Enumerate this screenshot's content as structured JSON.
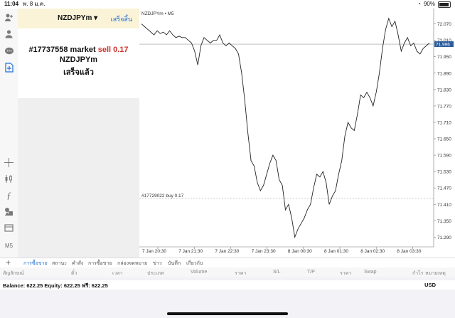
{
  "status_bar": {
    "time": "11:04",
    "date": "พ. 8 ม.ค.",
    "battery": "90%",
    "battery_level": 0.9
  },
  "panel": {
    "symbol": "NZDJPYm ▾",
    "done_label": "เสร็จสิ้น",
    "order_line": "#17737558 market",
    "order_side": "sell",
    "order_volume": "0.17",
    "order_symbol": "NZDJPYm",
    "order_status": "เสร็จแล้ว"
  },
  "toolbar": {
    "icons": [
      "user-add-icon",
      "account-icon",
      "chat-icon",
      "new-order-icon",
      "crosshair-icon",
      "candles-icon",
      "indicator-f-icon",
      "objects-icon",
      "template-icon",
      "timeframe-m5"
    ],
    "timeframe": "M5"
  },
  "chart": {
    "label": "NZDJPYm • M5",
    "price_tag": "71.996",
    "order_line_label": "#17729022 buy 0.17"
  },
  "chart_data": {
    "type": "line",
    "symbol": "NZDJPYm",
    "timeframe": "M5",
    "y_ticks": [
      "72.070",
      "72.010",
      "71.950",
      "71.890",
      "71.830",
      "71.770",
      "71.710",
      "71.650",
      "71.590",
      "71.530",
      "71.470",
      "71.410",
      "71.350",
      "71.290"
    ],
    "x_ticks": [
      "7 Jan 20:30",
      "7 Jan 21:30",
      "7 Jan 22:30",
      "7 Jan 23:30",
      "8 Jan 00:30",
      "8 Jan 01:30",
      "8 Jan 02:30",
      "8 Jan 03:30"
    ],
    "ylim": [
      71.265,
      72.095
    ],
    "current_price": 71.996,
    "order_level": 71.432,
    "series": [
      {
        "values": [
          72.07,
          72.06,
          72.05,
          72.04,
          72.03,
          72.045,
          72.035,
          72.04,
          72.03,
          72.045,
          72.03,
          72.02,
          72.025,
          72.02,
          72.02,
          72.01,
          72.0,
          71.97,
          71.92,
          71.99,
          72.02,
          72.01,
          72.0,
          72.01,
          72.01,
          72.03,
          72.0,
          71.99,
          72.0,
          71.99,
          71.98,
          71.96,
          71.89,
          71.79,
          71.67,
          71.57,
          71.55,
          71.49,
          71.46,
          71.48,
          71.52,
          71.56,
          71.59,
          71.57,
          71.5,
          71.48,
          71.39,
          71.41,
          71.36,
          71.29,
          71.32,
          71.34,
          71.36,
          71.39,
          71.41,
          71.47,
          71.52,
          71.51,
          71.53,
          71.49,
          71.41,
          71.44,
          71.46,
          71.52,
          71.57,
          71.66,
          71.71,
          71.69,
          71.68,
          71.74,
          71.81,
          71.8,
          71.82,
          71.8,
          71.77,
          71.82,
          71.89,
          71.98,
          72.05,
          72.09,
          72.06,
          72.08,
          72.03,
          71.97,
          72.0,
          72.02,
          71.99,
          72.0,
          71.97,
          71.96,
          71.98,
          71.99,
          72.0
        ]
      }
    ]
  },
  "bottom_tabs": [
    "การซื้อขาย",
    "สถานะ",
    "คำสั่ง",
    "การซื้อขาย",
    "กล่องจดหมาย",
    "ข่าว",
    "บันทึก",
    "เกี่ยวกับ"
  ],
  "columns": [
    "สัญลักษณ์",
    "ตั๋ว",
    "เวลา",
    "ประเภท",
    "Volume",
    "ราคา",
    "S/L",
    "T/P",
    "ราคา",
    "Swap",
    "กำไร",
    "หมายเหตุ"
  ],
  "balance": {
    "text": "Balance: 622.25  Equity: 622.25  ฟรี: 622.25",
    "currency": "USD"
  }
}
